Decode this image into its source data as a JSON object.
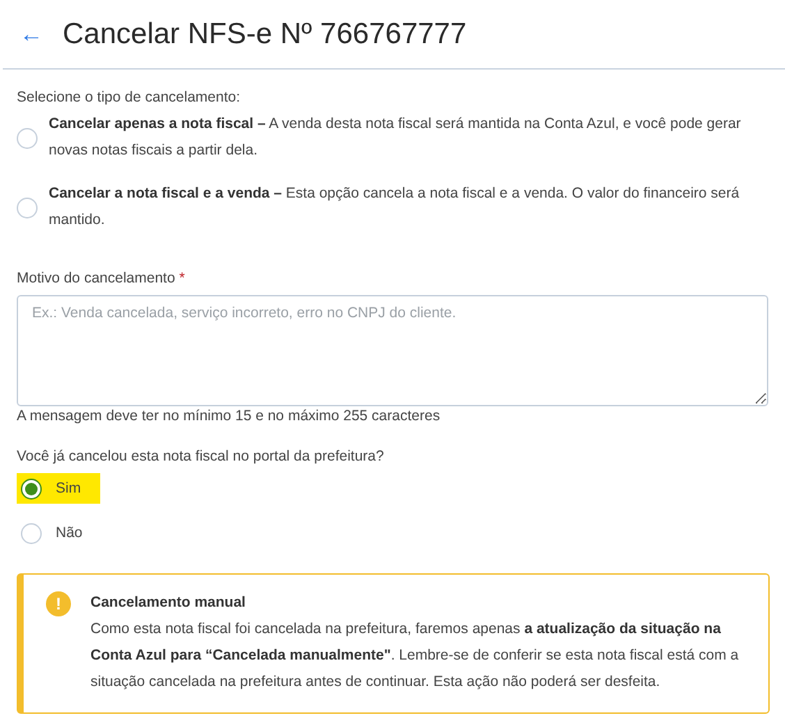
{
  "header": {
    "back_icon": "←",
    "title": "Cancelar NFS-e Nº 766767777"
  },
  "cancel_type": {
    "label": "Selecione o tipo de cancelamento:",
    "options": [
      {
        "text": "**Cancelar apenas a nota fiscal –** A venda desta nota fiscal será mantida na Conta Azul, e você pode gerar novas notas fiscais a partir dela.",
        "selected": false
      },
      {
        "text": "**Cancelar a nota fiscal e a venda –** Esta opção cancela a nota fiscal e a venda. O valor do financeiro será mantido.",
        "selected": false
      }
    ]
  },
  "reason": {
    "label": "Motivo do cancelamento",
    "required_mark": "*",
    "placeholder": "Ex.: Venda cancelada, serviço incorreto, erro no CNPJ do cliente.",
    "hint": "A mensagem deve ter no mínimo 15 e no máximo 255 caracteres"
  },
  "portal_question": {
    "label": "Você já cancelou esta nota fiscal no portal da prefeitura?",
    "options": [
      {
        "label": "Sim",
        "selected": true,
        "highlighted": true
      },
      {
        "label": "Não",
        "selected": false,
        "highlighted": false
      }
    ]
  },
  "alert": {
    "kind": "warning",
    "icon": "!",
    "title": "Cancelamento manual",
    "text": "Como esta nota fiscal foi cancelada na prefeitura, faremos apenas **a atualização da situação na Conta Azul para “Cancelada manualmente\"**. Lembre-se de conferir se esta nota fiscal está com a situação cancelada na prefeitura antes de continuar. Esta ação não poderá ser desfeita."
  }
}
